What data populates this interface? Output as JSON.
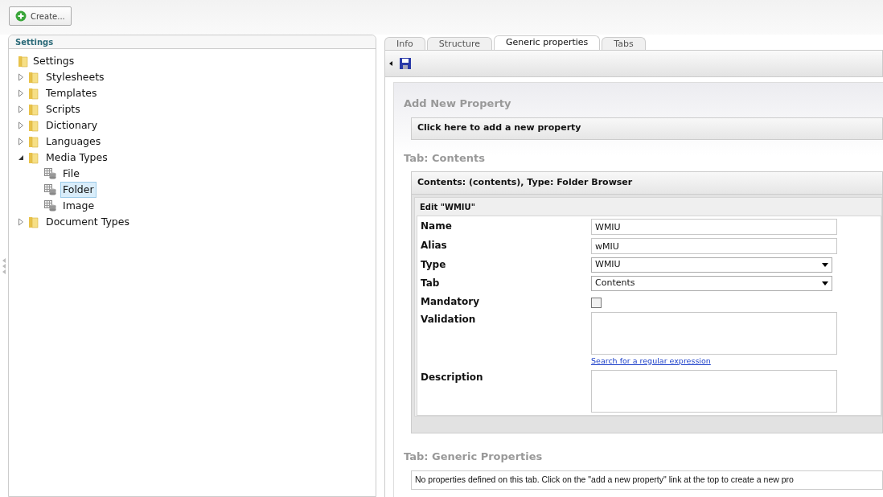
{
  "toolbar": {
    "create_button": "Create..."
  },
  "tree_panel": {
    "title": "Settings",
    "root": {
      "label": "Settings",
      "children": [
        {
          "label": "Stylesheets",
          "kind": "folder",
          "expanded": false,
          "selected": false
        },
        {
          "label": "Templates",
          "kind": "folder",
          "expanded": false,
          "selected": false
        },
        {
          "label": "Scripts",
          "kind": "folder",
          "expanded": false,
          "selected": false
        },
        {
          "label": "Dictionary",
          "kind": "folder",
          "expanded": false,
          "selected": false
        },
        {
          "label": "Languages",
          "kind": "folder",
          "expanded": false,
          "selected": false
        },
        {
          "label": "Media Types",
          "kind": "folder",
          "expanded": true,
          "selected": false,
          "children": [
            {
              "label": "File",
              "kind": "media_type",
              "selected": false
            },
            {
              "label": "Folder",
              "kind": "media_type",
              "selected": true
            },
            {
              "label": "Image",
              "kind": "media_type",
              "selected": false
            }
          ]
        },
        {
          "label": "Document Types",
          "kind": "folder",
          "expanded": false,
          "selected": false
        }
      ]
    }
  },
  "tabs": [
    {
      "label": "Info",
      "selected": false
    },
    {
      "label": "Structure",
      "selected": false
    },
    {
      "label": "Generic properties",
      "selected": true
    },
    {
      "label": "Tabs",
      "selected": false
    }
  ],
  "content": {
    "add_heading": "Add New Property",
    "add_bar": "Click here to add a new property",
    "tab_contents_heading": "Tab: Contents",
    "property_header": "Contents: (contents), Type: Folder Browser",
    "edit_header": "Edit \"WMIU\"",
    "fields": [
      {
        "kind": "text",
        "label": "Name",
        "value": "WMIU"
      },
      {
        "kind": "text",
        "label": "Alias",
        "value": "wMIU"
      },
      {
        "kind": "select",
        "label": "Type",
        "value": "WMIU"
      },
      {
        "kind": "select",
        "label": "Tab",
        "value": "Contents"
      },
      {
        "kind": "checkbox",
        "label": "Mandatory",
        "checked": false
      },
      {
        "kind": "textarea",
        "label": "Validation",
        "link": "Search for a regular expression"
      },
      {
        "kind": "textarea",
        "label": "Description"
      }
    ],
    "tab_generic_heading": "Tab: Generic Properties",
    "empty_message": "No properties defined on this tab. Click on the \"add a new property\" link at the top to create a new pro"
  }
}
